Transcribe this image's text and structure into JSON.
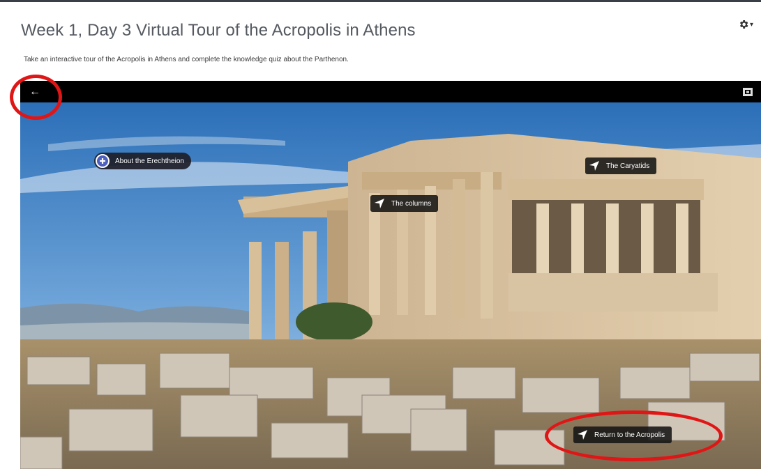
{
  "page": {
    "title": "Week 1, Day 3 Virtual Tour of the Acropolis in Athens",
    "intro": "Take an interactive tour of the Acropolis in Athens and complete the knowledge quiz about the Parthenon.",
    "settings_icon": "gear-icon"
  },
  "viewer": {
    "toolbar": {
      "back_icon": "back-arrow-icon",
      "back_glyph": "←",
      "fullscreen_icon": "fullscreen-icon"
    },
    "hotspots": [
      {
        "label": "About the Erechtheion",
        "icon": "info-plus-icon"
      },
      {
        "label": "The columns",
        "icon": "navigate-arrow-icon"
      },
      {
        "label": "The Caryatids",
        "icon": "navigate-arrow-icon"
      },
      {
        "label": "Return to the Acropolis",
        "icon": "navigate-arrow-icon"
      }
    ]
  },
  "colors": {
    "annotation": "#e01616",
    "info_hotspot": "#4d5fbf",
    "toolbar": "#000000"
  }
}
